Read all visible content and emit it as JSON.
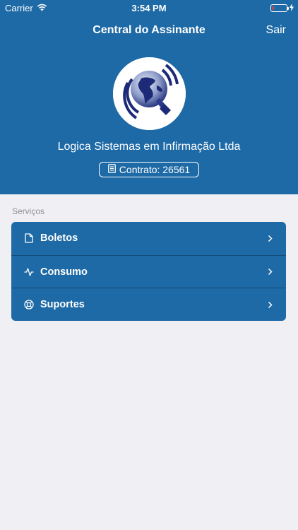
{
  "status_bar": {
    "carrier": "Carrier",
    "time": "3:54 PM"
  },
  "nav": {
    "title": "Central do Assinante",
    "action_label": "Sair"
  },
  "header": {
    "company_name": "Logica Sistemas em Infirmação Ltda",
    "contract_label": "Contrato: 26561"
  },
  "services": {
    "section_title": "Serviços",
    "items": [
      {
        "label": "Boletos",
        "icon": "document-icon"
      },
      {
        "label": "Consumo",
        "icon": "activity-icon"
      },
      {
        "label": "Suportes",
        "icon": "lifebuoy-icon"
      }
    ]
  },
  "colors": {
    "primary": "#1e6aa6",
    "background": "#efeff4",
    "divider": "#134a78"
  }
}
